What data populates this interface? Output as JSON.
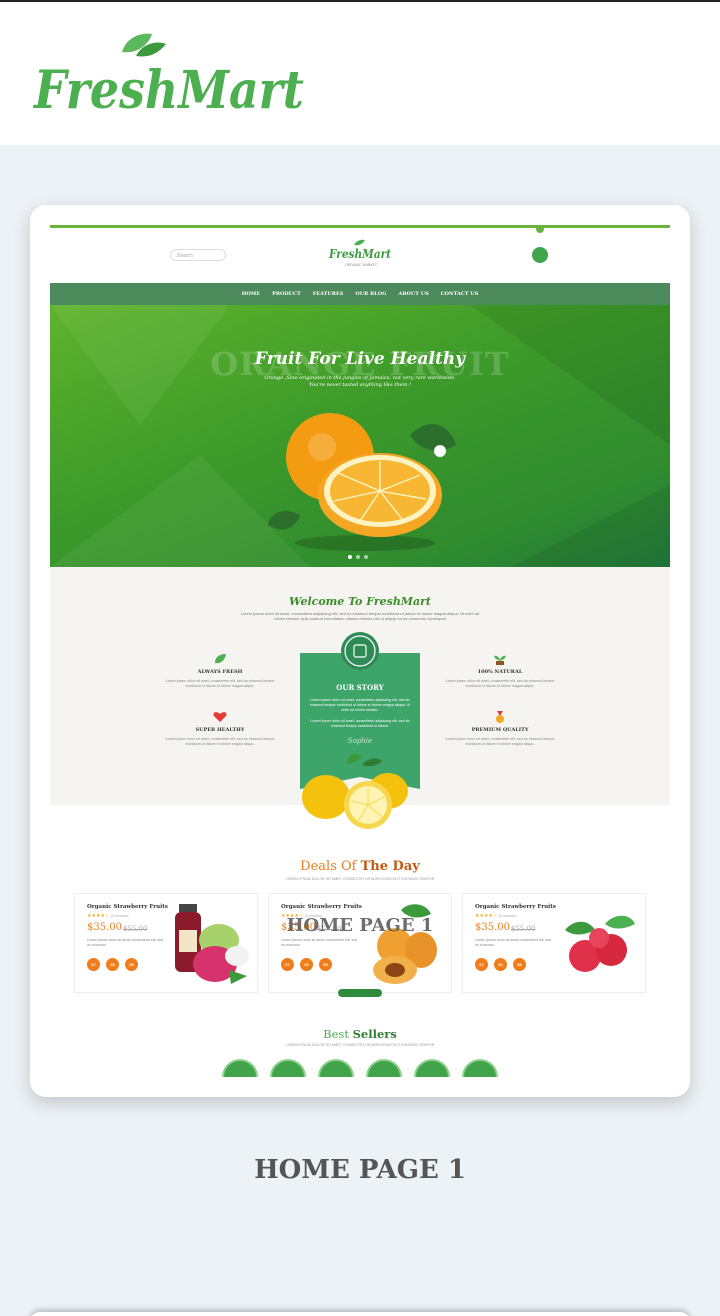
{
  "brand": {
    "logo_text": "FreshMart",
    "accent": "#4caf50"
  },
  "preview": {
    "search_placeholder": "Search",
    "logo_text": "FreshMart",
    "logo_tagline": "ORGANIC MARKET",
    "nav": [
      "HOME",
      "PRODUCT",
      "FEATURES",
      "OUR BLOG",
      "ABOUT US",
      "CONTACT US"
    ],
    "hero": {
      "bg_text": "ORANGE FRUIT",
      "title": "Fruit For Live Healthy",
      "subtitle_1": "Orange ,Sino originated in the jungles of Jamaica, not very rare worldwide.",
      "subtitle_2": "You're never tasted anything like them !"
    },
    "welcome": {
      "title": "Welcome To FreshMart",
      "text": "Lorem Ipsum dolor sit amet, consectetur adipiscing elit, sed do eiusmod tempor incididunt ut labore et dolore magna aliqua. Ut enim ad minim veniam, quis nostrud exercitation ullamco laboris nisi ut aliquip ex ea commodo consequat",
      "features": [
        {
          "title": "ALWAYS FRESH",
          "icon": "leaf-icon"
        },
        {
          "title": "SUPER HEALTHY",
          "icon": "heart-icon"
        },
        {
          "title": "100% NATURAL",
          "icon": "sprout-icon"
        },
        {
          "title": "PREMIUM QUALITY",
          "icon": "medal-icon"
        }
      ],
      "feature_desc": "Lorem ipsum dolor sit amet, consectetur elit, sed do eiusmod tempor incididunt ut labore et dolore magna aliqua.",
      "story_title": "OUR STORY",
      "story_text": "Lorem ipsum dolor sit amet, consectetur adipiscing elit, sed do eiusmod tempor incididunt ut labore et dolore magna aliqua. Ut enim ad minim veniam.",
      "story_text_2": "Lorem ipsum dolor sit amet, consectetur adipiscing elit, sed do eiusmod tempor incididunt ut labore.",
      "signature": "Sophie"
    },
    "deals": {
      "title_light": "Deals Of",
      "title_bold": "The Day",
      "subtitle": "LOREM IPSUM DOLOR SIT AMET CONSECTETUR ADIPISCING ELIT EIUSMOD TEMPOR",
      "products": [
        {
          "name": "Organic Strawberry Fruits",
          "stars": "★★★★☆",
          "reviews": "(3 reviews)",
          "price": "$35.00",
          "old_price": "$55.00"
        },
        {
          "name": "Organic Strawberry Fruits",
          "stars": "★★★★☆",
          "reviews": "(3 reviews)",
          "price": "$35.00",
          "old_price": "$55.00"
        },
        {
          "name": "Organic Strawberry Fruits",
          "stars": "★★★★☆",
          "reviews": "(3 reviews)",
          "price": "$35.00",
          "old_price": "$55.00"
        }
      ],
      "product_desc": "Lorem ipsum dolor sit amet consectetur elit, sed do eiusmod.",
      "countdown": [
        "67",
        "30",
        "55"
      ]
    },
    "overlay_label": "HOME PAGE 1",
    "best": {
      "title_light": "Best",
      "title_bold": "Sellers",
      "subtitle": "LOREM IPSUM DOLOR SIT AMET CONSECTETUR ADIPISCING ELIT EIUSMOD TEMPOR"
    }
  },
  "caption": "HOME PAGE 1"
}
